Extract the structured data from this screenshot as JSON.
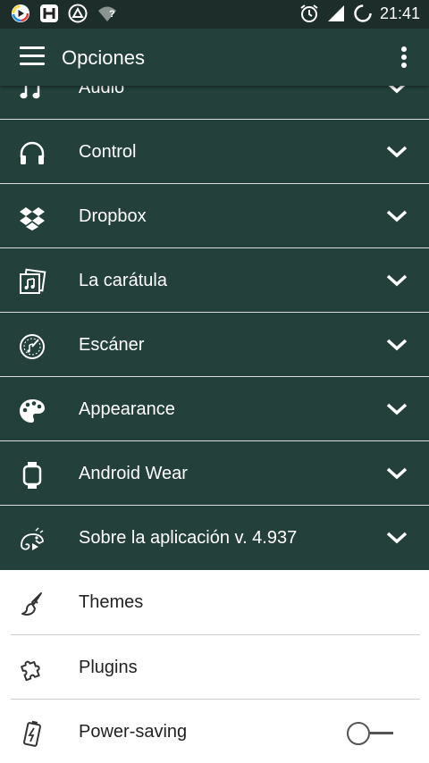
{
  "status_bar": {
    "time": "21:41",
    "wifi_badge": "?"
  },
  "app_bar": {
    "title": "Opciones",
    "left_icon": "menu-icon",
    "right_icon": "more-vertical-icon"
  },
  "sections": [
    {
      "label": "Audio",
      "icon": "music-note-icon"
    },
    {
      "label": "Control",
      "icon": "headphones-icon"
    },
    {
      "label": "Dropbox",
      "icon": "dropbox-icon"
    },
    {
      "label": "La carátula",
      "icon": "album-art-icon"
    },
    {
      "label": "Escáner",
      "icon": "scanner-icon"
    },
    {
      "label": "Appearance",
      "icon": "palette-icon"
    },
    {
      "label": "Android Wear",
      "icon": "watch-icon"
    },
    {
      "label": "Sobre la aplicación v. 4.937",
      "icon": "chameleon-icon"
    }
  ],
  "items": [
    {
      "label": "Themes",
      "icon": "brush-icon"
    },
    {
      "label": "Plugins",
      "icon": "puzzle-icon"
    },
    {
      "label": "Power-saving",
      "icon": "battery-icon",
      "toggle_on": false
    }
  ],
  "colors": {
    "status_bar": "#1d2d2a",
    "app_bar": "#23403b",
    "section_bg": "#23403b",
    "section_divider": "#d8dedd",
    "light_bg": "#ffffff"
  }
}
